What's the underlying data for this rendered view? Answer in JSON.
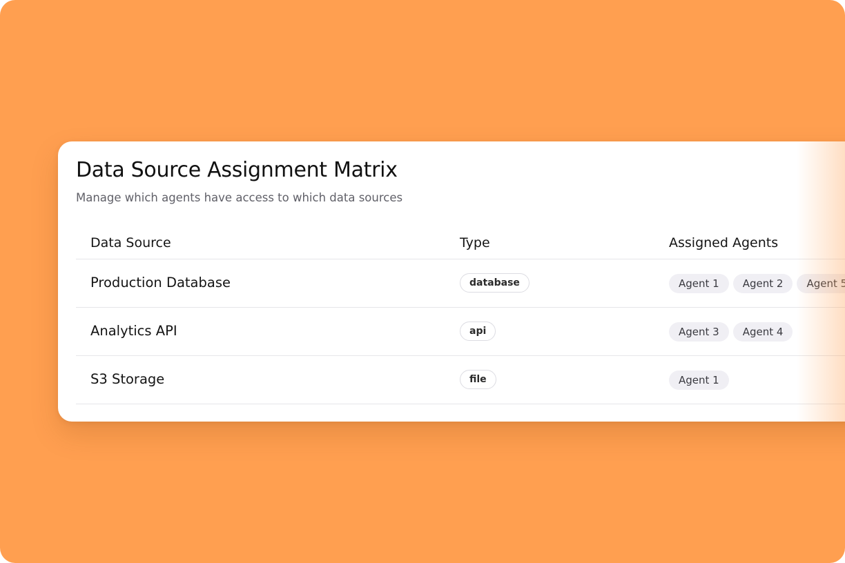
{
  "card": {
    "title": "Data Source Assignment Matrix",
    "subtitle": "Manage which agents have access to which data sources"
  },
  "table": {
    "columns": [
      "Data Source",
      "Type",
      "Assigned Agents"
    ],
    "rows": [
      {
        "source": "Production Database",
        "type": "database",
        "agents": [
          "Agent 1",
          "Agent 2",
          "Agent 5"
        ]
      },
      {
        "source": "Analytics API",
        "type": "api",
        "agents": [
          "Agent 3",
          "Agent 4"
        ]
      },
      {
        "source": "S3 Storage",
        "type": "file",
        "agents": [
          "Agent 1"
        ]
      }
    ]
  },
  "colors": {
    "background": "#ff9f50",
    "card": "#ffffff",
    "agent_chip": "#f0eff4",
    "divider": "#e6e6e9"
  }
}
